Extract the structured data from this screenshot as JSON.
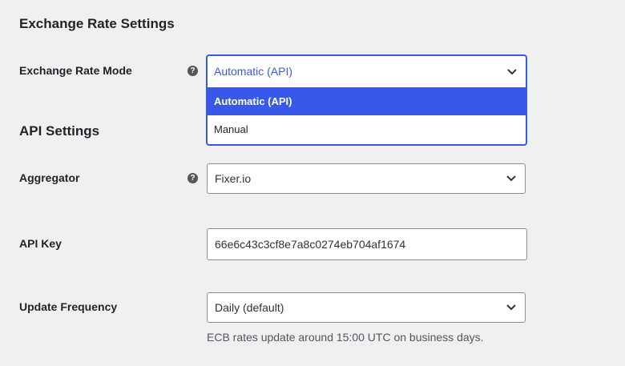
{
  "sections": {
    "exchange_title": "Exchange Rate Settings",
    "api_title": "API Settings"
  },
  "exchange_rate_mode": {
    "label": "Exchange Rate Mode",
    "help": "?",
    "value": "Automatic (API)",
    "options": [
      {
        "label": "Automatic (API)",
        "selected": true
      },
      {
        "label": "Manual",
        "selected": false
      }
    ]
  },
  "aggregator": {
    "label": "Aggregator",
    "help": "?",
    "value": "Fixer.io"
  },
  "api_key": {
    "label": "API Key",
    "value": "66e6c43c3cf8e7a8c0274eb704af1674"
  },
  "update_frequency": {
    "label": "Update Frequency",
    "value": "Daily (default)",
    "description": "ECB rates update around 15:00 UTC on business days."
  },
  "colors": {
    "accent": "#3858e9",
    "background": "#f0f0f1",
    "text": "#1d2327",
    "muted": "#50575e"
  }
}
